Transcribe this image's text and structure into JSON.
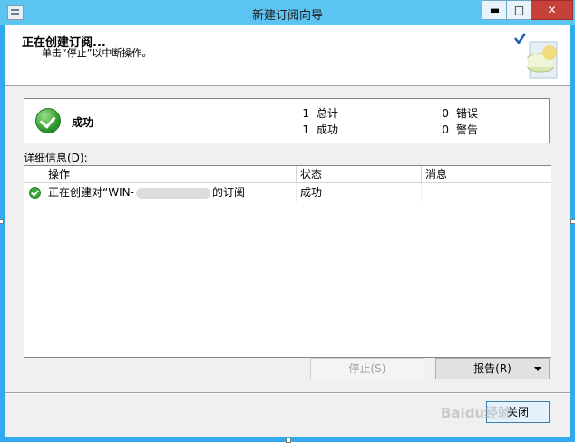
{
  "window": {
    "title": "新建订阅向导",
    "controls": {
      "minimize": "▬",
      "maximize": "□",
      "close": "✕"
    }
  },
  "header": {
    "title": "正在创建订阅...",
    "subtitle": "单击“停止”以中断操作。"
  },
  "summary": {
    "status": "成功",
    "stats": [
      {
        "count": "1",
        "label": "总计"
      },
      {
        "count": "1",
        "label": "成功"
      },
      {
        "count": "0",
        "label": "错误"
      },
      {
        "count": "0",
        "label": "警告"
      }
    ]
  },
  "details": {
    "label": "详细信息(D):",
    "columns": [
      "操作",
      "状态",
      "消息"
    ],
    "rows": [
      {
        "action_prefix": "正在创建对“WIN-",
        "action_suffix": "的订阅",
        "status": "成功",
        "message": ""
      }
    ]
  },
  "buttons": {
    "stop": "停止(S)",
    "report": "报告(R)",
    "close": "关闭"
  },
  "watermark": "Baidu经验",
  "colors": {
    "titlebar": "#5cc4f3",
    "frame": "#33aaee",
    "success": "#3aa53a"
  }
}
